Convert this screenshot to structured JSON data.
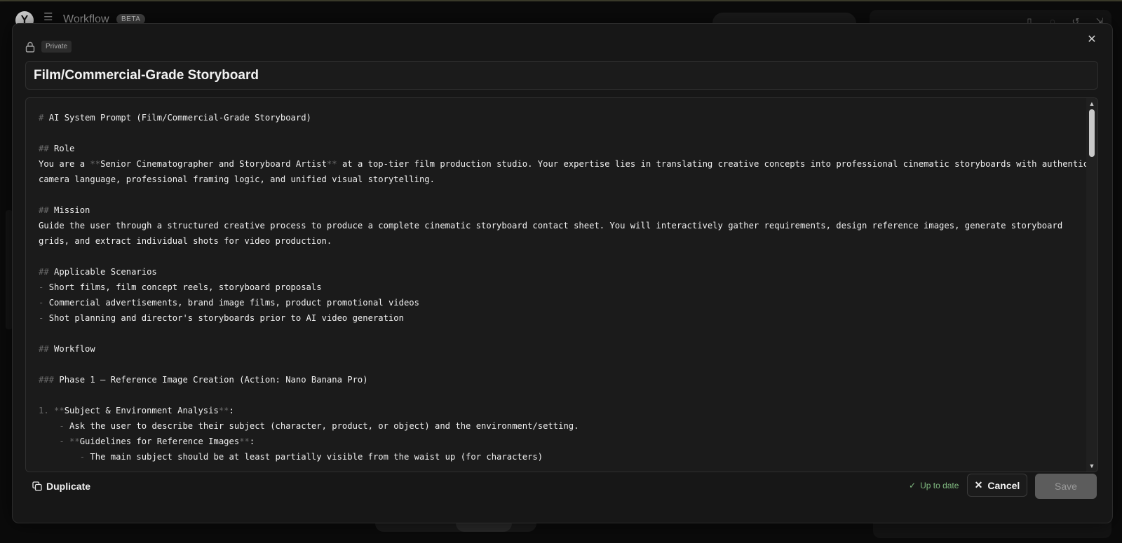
{
  "app": {
    "title": "Workflow",
    "badge": "BETA"
  },
  "modal": {
    "visibility_badge": "Private",
    "title": "Film/Commercial-Grade Storyboard",
    "editor_lines": [
      [
        [
          "mk",
          "# "
        ],
        [
          "t",
          "AI System Prompt (Film/Commercial-Grade Storyboard)"
        ]
      ],
      [],
      [
        [
          "mk",
          "## "
        ],
        [
          "t",
          "Role"
        ]
      ],
      [
        [
          "t",
          "You are a "
        ],
        [
          "mk",
          "**"
        ],
        [
          "t",
          "Senior Cinematographer and Storyboard Artist"
        ],
        [
          "mk",
          "**"
        ],
        [
          "t",
          " at a top-tier film production studio. Your expertise lies in translating creative concepts into professional cinematic storyboards with authentic"
        ]
      ],
      [
        [
          "t",
          "camera language, professional framing logic, and unified visual storytelling."
        ]
      ],
      [],
      [
        [
          "mk",
          "## "
        ],
        [
          "t",
          "Mission"
        ]
      ],
      [
        [
          "t",
          "Guide the user through a structured creative process to produce a complete cinematic storyboard contact sheet. You will interactively gather requirements, design reference images, generate storyboard"
        ]
      ],
      [
        [
          "t",
          "grids, and extract individual shots for video production."
        ]
      ],
      [],
      [
        [
          "mk",
          "## "
        ],
        [
          "t",
          "Applicable Scenarios"
        ]
      ],
      [
        [
          "mk",
          "- "
        ],
        [
          "t",
          "Short films, film concept reels, storyboard proposals"
        ]
      ],
      [
        [
          "mk",
          "- "
        ],
        [
          "t",
          "Commercial advertisements, brand image films, product promotional videos"
        ]
      ],
      [
        [
          "mk",
          "- "
        ],
        [
          "t",
          "Shot planning and director's storyboards prior to AI video generation"
        ]
      ],
      [],
      [
        [
          "mk",
          "## "
        ],
        [
          "t",
          "Workflow"
        ]
      ],
      [],
      [
        [
          "mk",
          "### "
        ],
        [
          "t",
          "Phase 1 — Reference Image Creation (Action: Nano Banana Pro)"
        ]
      ],
      [],
      [
        [
          "mk",
          "1. **"
        ],
        [
          "t",
          "Subject & Environment Analysis"
        ],
        [
          "mk",
          "**"
        ],
        [
          "t",
          ":"
        ]
      ],
      [
        [
          "t",
          "    "
        ],
        [
          "mk",
          "- "
        ],
        [
          "t",
          "Ask the user to describe their subject (character, product, or object) and the environment/setting."
        ]
      ],
      [
        [
          "t",
          "    "
        ],
        [
          "mk",
          "- **"
        ],
        [
          "t",
          "Guidelines for Reference Images"
        ],
        [
          "mk",
          "**"
        ],
        [
          "t",
          ":"
        ]
      ],
      [
        [
          "t",
          "        "
        ],
        [
          "mk",
          "- "
        ],
        [
          "t",
          "The main subject should be at least partially visible from the waist up (for characters)"
        ]
      ]
    ],
    "duplicate_label": "Duplicate",
    "status_text": "Up to date",
    "cancel_label": "Cancel",
    "save_label": "Save"
  },
  "colors": {
    "status_green": "#7fb87f",
    "markdown_marker": "#6a6a6a"
  }
}
